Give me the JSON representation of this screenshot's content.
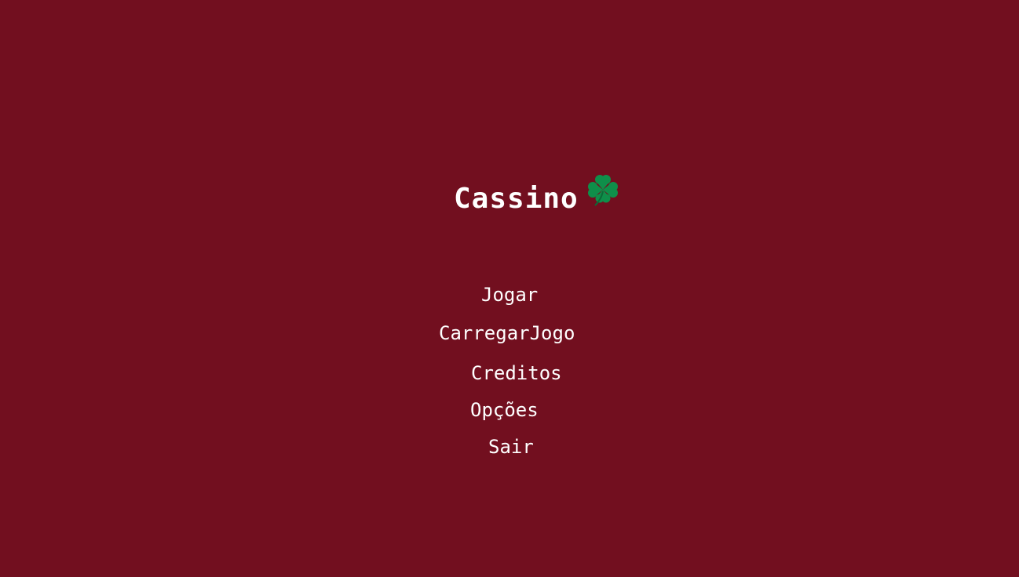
{
  "game": {
    "title": "Cassino",
    "title_icon": "four-leaf-clover-icon",
    "menu": [
      {
        "label": "Jogar"
      },
      {
        "label": "CarregarJogo"
      },
      {
        "label": "Creditos"
      },
      {
        "label": "Opções"
      },
      {
        "label": "Sair"
      }
    ]
  },
  "colors": {
    "background": "#720f1f",
    "text": "#ffffff",
    "clover": "#0f8f4a"
  }
}
